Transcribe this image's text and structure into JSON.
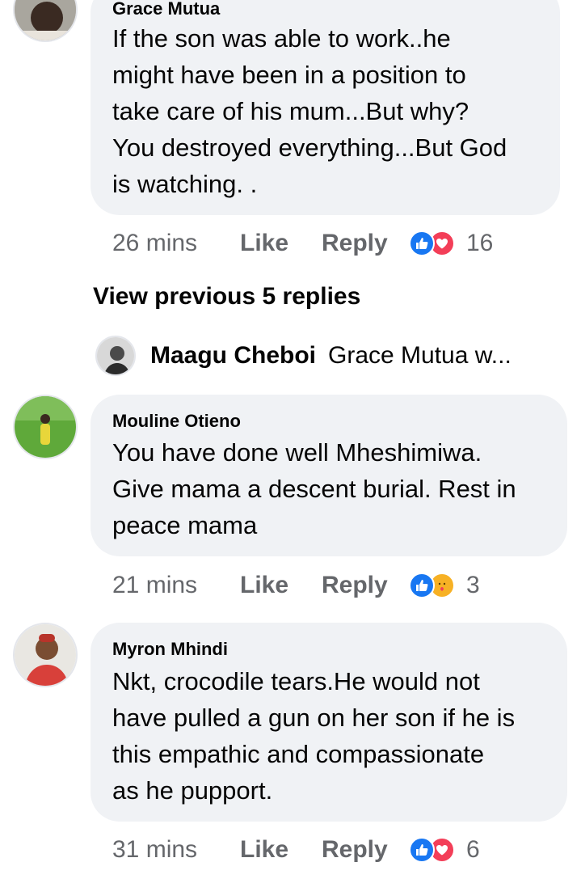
{
  "comments": [
    {
      "author": "Grace Mutua",
      "text_lines": [
        "If the son was able to work..he",
        "might  have been in a position to",
        "take care of his mum...But why?",
        "You destroyed everything...But God",
        "is watching. ."
      ],
      "time": "26 mins",
      "like_label": "Like",
      "reply_label": "Reply",
      "reactions": [
        "like-icon",
        "love-icon"
      ],
      "reaction_count": "16"
    },
    {
      "author": "Mouline Otieno",
      "text_lines": [
        "You have done well Mheshimiwa.",
        "Give mama a descent burial. Rest in",
        "peace mama"
      ],
      "time": "21 mins",
      "like_label": "Like",
      "reply_label": "Reply",
      "reactions": [
        "like-icon",
        "care-icon"
      ],
      "reaction_count": "3"
    },
    {
      "author": "Myron Mhindi",
      "text_lines": [
        "Nkt, crocodile tears.He would not",
        "have pulled a gun on her son if he is",
        "this empathic and compassionate",
        "as he pupport."
      ],
      "time": "31 mins",
      "like_label": "Like",
      "reply_label": "Reply",
      "reactions": [
        "like-icon",
        "love-icon"
      ],
      "reaction_count": "6"
    }
  ],
  "view_previous": "View previous 5 replies",
  "reply_preview": {
    "author": "Maagu Cheboi",
    "text": "Grace Mutua w..."
  },
  "colors": {
    "bubble": "#f0f2f5",
    "meta_text": "#65676b",
    "like_blue": "#1877f2",
    "love_red": "#f33e58",
    "care_yellow": "#f7b125"
  }
}
